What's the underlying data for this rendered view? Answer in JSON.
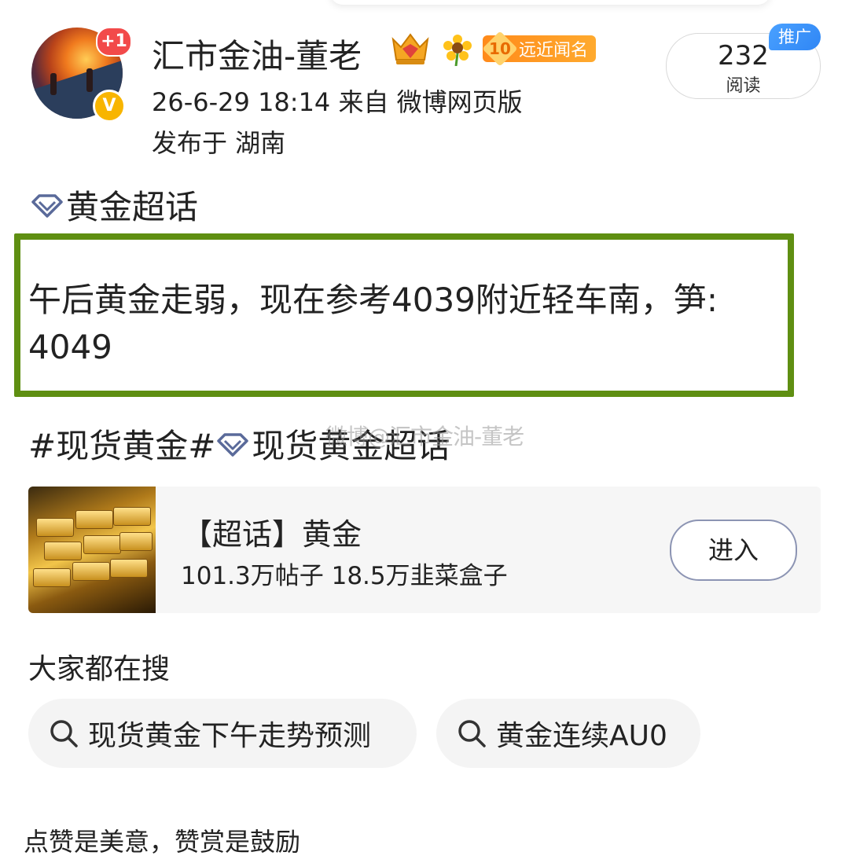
{
  "header": {
    "username": "汇市金油-董老",
    "plus_badge": "+1",
    "verify_badge": "V",
    "fame_badge_level": "10",
    "fame_badge_label": "远近闻名",
    "meta": "26-6-29 18:14  来自 微博网页版",
    "location": "发布于 湖南",
    "read_count": "232",
    "read_label": "阅读",
    "promo_label": "推广"
  },
  "post": {
    "topic": "黄金超话",
    "text": "午后黄金走弱，现在参考4039附近轻车南，笋: 4049",
    "tag_hash": "#现货黄金#",
    "tag_topic": "现货黄金超话",
    "watermark": "微博@汇市金油-董老"
  },
  "card": {
    "title": "【超话】黄金",
    "stats": "101.3万帖子 18.5万韭菜盒子",
    "enter_label": "进入"
  },
  "search": {
    "title": "大家都在搜",
    "items": [
      "现货黄金下午走势预测",
      "黄金连续AU0"
    ]
  },
  "footer": {
    "text": "点赞是美意，赞赏是鼓励"
  },
  "colors": {
    "highlight_border": "#5f8f12",
    "promo": "#3a92f7",
    "fame": "#ff9a22",
    "plus_badge": "#f24a4a",
    "verify": "#f8b500"
  }
}
